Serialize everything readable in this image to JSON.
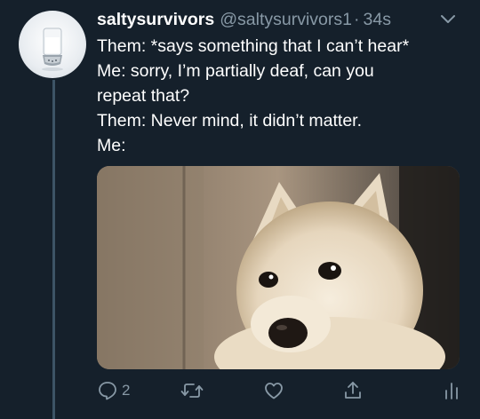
{
  "tweet": {
    "display_name": "saltysurvivors",
    "handle": "@saltysurvivors1",
    "separator": "·",
    "time": "34s",
    "lines": [
      "Them: *says something that I can’t hear*",
      "Me: sorry, I’m partially deaf, can you",
      "repeat that?",
      "Them: Never mind, it didn’t matter.",
      "Me:"
    ]
  },
  "actions": {
    "reply_count": "2"
  },
  "icons": {
    "avatar": "salt-shaker",
    "menu": "chevron-down-icon",
    "reply": "reply-icon",
    "retweet": "retweet-icon",
    "like": "heart-icon",
    "share": "share-icon",
    "analytics": "analytics-icon"
  },
  "colors": {
    "background": "#15202b",
    "text": "#ffffff",
    "secondary_text": "#8899a6",
    "thread_line": "#3d5466"
  }
}
